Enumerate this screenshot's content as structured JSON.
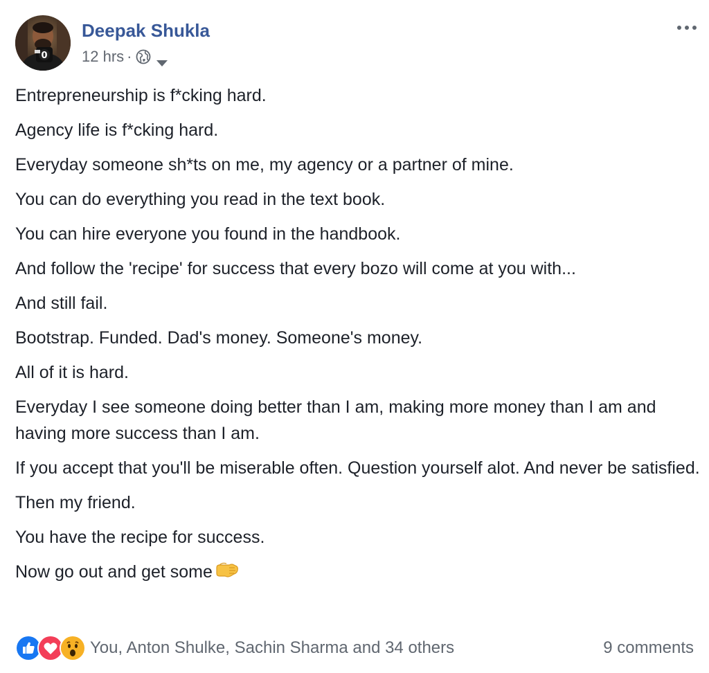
{
  "author": {
    "name": "Deepak Shukla",
    "avatar_icon": "profile-photo-with-microphone"
  },
  "meta": {
    "time": "12 hrs",
    "separator": "·",
    "privacy_icon": "globe-icon",
    "menu_icon": "caret-down-icon"
  },
  "more_options_icon": "more-dots-icon",
  "paragraphs": [
    "Entrepreneurship is f*cking hard.",
    "Agency life is f*cking hard.",
    "Everyday someone sh*ts on me, my agency or a partner of mine.",
    "You can do everything you read in the text book.",
    "You can hire everyone you found in the handbook.",
    "And follow the 'recipe' for success that every bozo will come at you with...",
    "And still fail.",
    "Bootstrap. Funded. Dad's money. Someone's money.",
    "All of it is hard.",
    "Everyday I see someone doing better than I am, making more money than I am and having more success than I am.",
    "If you accept that you'll be miserable often. Question yourself alot. And never be satisfied.",
    "Then my friend.",
    "You have the recipe for success.",
    "Now go out and get some"
  ],
  "last_line_emoji": "right-facing-fist-emoji",
  "reactions": {
    "icons": [
      "like-icon",
      "love-icon",
      "wow-icon"
    ],
    "reactors_text": "You, Anton Shulke, Sachin Sharma and 34 others",
    "comments_text": "9 comments"
  },
  "colors": {
    "name_link": "#385898",
    "secondary_text": "#606770",
    "body_text": "#1d2129",
    "like_blue": "#1877f2",
    "love_red": "#f33e58",
    "wow_yellow": "#f7b125"
  }
}
